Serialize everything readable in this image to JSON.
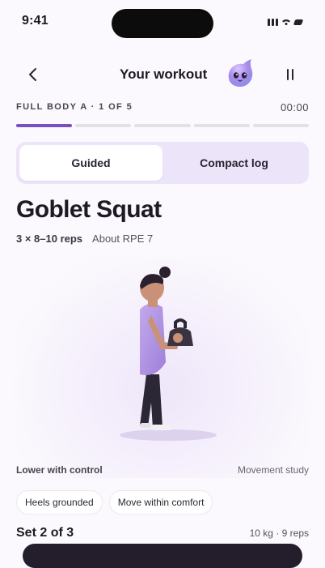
{
  "status_bar": {
    "time": "9:41"
  },
  "header": {
    "title": "Your workout",
    "back_icon": "chevron-left-icon",
    "pause_icon": "pause-icon"
  },
  "progress": {
    "label": "FULL BODY A · 1 OF 5",
    "elapsed": "00:00",
    "total_segments": 5,
    "completed_segments": 1,
    "accent": "#7a4fc2"
  },
  "mode_toggle": {
    "options": [
      {
        "label": "Guided",
        "selected": true
      },
      {
        "label": "Compact log",
        "selected": false
      }
    ]
  },
  "exercise": {
    "name": "Goblet Squat",
    "prescription": "3 × 8–10 reps",
    "intensity": "About RPE 7",
    "caption_left": "Lower with control",
    "caption_right": "Movement study",
    "cues": [
      "Heels grounded",
      "Move within comfort"
    ]
  },
  "set": {
    "label": "Set 2 of 3",
    "details": "10 kg · 9 reps"
  },
  "colors": {
    "background": "#fbf9fd",
    "toggle_bg": "#ece4f8",
    "bottom_bar": "#231d2c"
  }
}
